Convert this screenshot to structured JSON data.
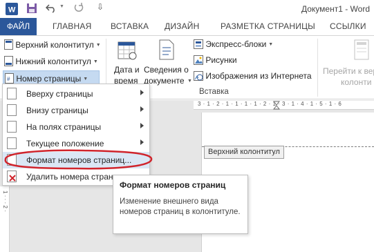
{
  "window": {
    "title": "Документ1 - Word"
  },
  "tabs": [
    "ФАЙЛ",
    "ГЛАВНАЯ",
    "ВСТАВКА",
    "ДИЗАЙН",
    "РАЗМЕТКА СТРАНИЦЫ",
    "ССЫЛКИ"
  ],
  "ribbon": {
    "header_label": "Верхний колонтитул",
    "footer_label": "Нижний колонтитул",
    "page_number_label": "Номер страницы",
    "datetime_line1": "Дата и",
    "datetime_line2": "время",
    "docinfo_line1": "Сведения о",
    "docinfo_line2": "документе",
    "quickparts_label": "Экспресс-блоки",
    "pictures_label": "Рисунки",
    "online_pictures_label": "Изображения из Интернета",
    "insert_group_label": "Вставка",
    "goto_header_line1": "Перейти к верх",
    "goto_header_line2": "колонти"
  },
  "menu": {
    "items": [
      {
        "label": "Вверху страницы",
        "submenu": true
      },
      {
        "label": "Внизу страницы",
        "submenu": true
      },
      {
        "label": "На полях страницы",
        "submenu": true
      },
      {
        "label": "Текущее положение",
        "submenu": true
      },
      {
        "label": "Формат номеров страниц...",
        "submenu": false
      },
      {
        "label": "Удалить номера страниц",
        "submenu": false
      }
    ]
  },
  "tooltip": {
    "title": "Формат номеров страниц",
    "body": "Изменение внешнего вида номеров страниц в колонтитуле."
  },
  "document": {
    "header_tag": "Верхний колонтитул",
    "ruler_marks": "3 · 1 · 2 · 1 · 1 · 1 · 1 · 2 · 1 · 3 · 1 · 4 · 1 · 5 · 1 · 6",
    "vertical_ruler_marks": "1 · · · 2 ·"
  },
  "colors": {
    "accent": "#2b579a",
    "highlight": "#dbe7f5",
    "annotation": "#d0242c"
  }
}
